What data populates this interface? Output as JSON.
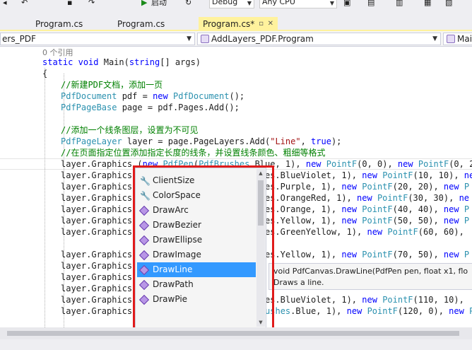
{
  "toolbar": {
    "start_label": "启动",
    "config_value": "Debug",
    "platform_value": "Any CPU"
  },
  "tabs": [
    {
      "label": "Program.cs",
      "active": false
    },
    {
      "label": "Program.cs",
      "active": false
    },
    {
      "label": "Program.cs*",
      "active": true
    }
  ],
  "nav": {
    "project_value": "ers_PDF",
    "class_value": "AddLayers_PDF.Program",
    "member_value": "Mai"
  },
  "code": {
    "reference_count": "0 个引用",
    "lines": [
      "static void Main(string[] args)",
      "{",
      "//新建PDF文档，添加一页",
      "PdfDocument pdf = new PdfDocument();",
      "PdfPageBase page = pdf.Pages.Add();",
      "",
      "//添加一个线条图层，设置为不可见",
      "PdfPageLayer layer = page.PageLayers.Add(\"Line\", true);",
      "//在页面指定位置添加指定长度的线条，并设置线条颜色、粗细等格式",
      "layer.Graphics.(new PdfPen(PdfBrushes.Blue, 1), new PointF(0, 0), new PointF(0, 200",
      "layer.Graphics.                        hes.BlueViolet, 1), new PointF(10, 10), ne",
      "layer.Graphics.                        hes.Purple, 1), new PointF(20, 20), new P",
      "layer.Graphics.                        hes.OrangeRed, 1), new PointF(30, 30), ne",
      "layer.Graphics.                        hes.Orange, 1), new PointF(40, 40), new P",
      "layer.Graphics.                        hes.Yellow, 1), new PointF(50, 50), new P",
      "layer.Graphics.                        hes.GreenYellow, 1), new PointF(60, 60),",
      "",
      "layer.Graphics.                        hes.Yellow, 1), new PointF(70, 50), new P",
      "layer.Graphics.",
      "layer.Graphics.",
      "layer.Graphics.                        ",
      "layer.Graphics.                        hes.BlueViolet, 1), new PointF(110, 10),",
      "layer.Graphics.DrawLine(new PdfPen(PdfBrushes.Blue, 1), new PointF(120, 0), new Poi"
    ]
  },
  "completion": {
    "items": [
      {
        "label": "ClientSize",
        "icon": "wrench-icon",
        "selected": false
      },
      {
        "label": "ColorSpace",
        "icon": "wrench-icon",
        "selected": false
      },
      {
        "label": "DrawArc",
        "icon": "method-icon",
        "selected": false
      },
      {
        "label": "DrawBezier",
        "icon": "method-icon",
        "selected": false
      },
      {
        "label": "DrawEllipse",
        "icon": "method-icon",
        "selected": false
      },
      {
        "label": "DrawImage",
        "icon": "method-icon",
        "selected": false
      },
      {
        "label": "DrawLine",
        "icon": "method-icon",
        "selected": true
      },
      {
        "label": "DrawPath",
        "icon": "method-icon",
        "selected": false
      },
      {
        "label": "DrawPie",
        "icon": "method-icon",
        "selected": false
      }
    ]
  },
  "tooltip": {
    "signature": "void PdfCanvas.DrawLine(PdfPen pen, float x1, flo",
    "description": "Draws a line."
  },
  "colors": {
    "active_tab": "#fff29d",
    "selection": "#3399ff",
    "highlight_box": "#e01b1b",
    "keyword": "#0000ff",
    "type": "#2b91af",
    "comment": "#008000",
    "string": "#a31515"
  }
}
